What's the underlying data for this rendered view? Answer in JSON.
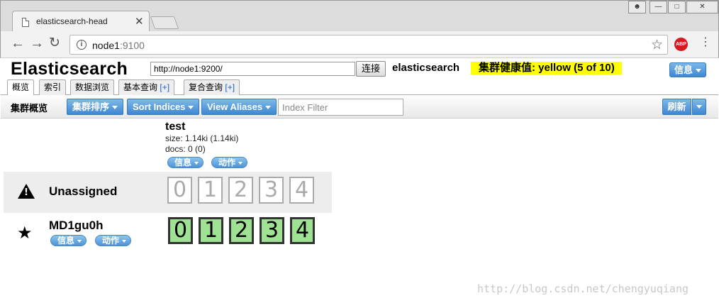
{
  "browser": {
    "tab_title": "elasticsearch-head",
    "url_host": "node1",
    "url_port": ":9100",
    "abp_label": "ABP"
  },
  "app": {
    "title": "Elasticsearch",
    "connect_url": "http://node1:9200/",
    "connect_button": "连接",
    "cluster_name": "elasticsearch",
    "health_text": "集群健康值: yellow (5 of 10)",
    "health_color": "#ffff00",
    "info_button": "信息"
  },
  "tabs": [
    {
      "label": "概览",
      "plus": ""
    },
    {
      "label": "索引",
      "plus": ""
    },
    {
      "label": "数据浏览",
      "plus": ""
    },
    {
      "label": "基本查询",
      "plus": "[+]"
    },
    {
      "label": "复合查询",
      "plus": "[+]"
    }
  ],
  "toolbar": {
    "title": "集群概览",
    "sort_button": "集群排序",
    "sort_indices_button": "Sort Indices",
    "view_aliases_button": "View Aliases",
    "index_filter_placeholder": "Index Filter",
    "refresh_button": "刷新"
  },
  "index": {
    "name": "test",
    "size": "size: 1.14ki (1.14ki)",
    "docs": "docs: 0 (0)",
    "info_label": "信息",
    "action_label": "动作"
  },
  "nodes": [
    {
      "label": "Unassigned",
      "shards": [
        "0",
        "1",
        "2",
        "3",
        "4"
      ],
      "shard_state": "unassigned"
    },
    {
      "label": "MD1gu0h",
      "info_label": "信息",
      "action_label": "动作",
      "shards": [
        "0",
        "1",
        "2",
        "3",
        "4"
      ],
      "shard_state": "assigned"
    }
  ],
  "colors": {
    "accent_blue": "#3e87d0",
    "assigned_shard": "#9fe293",
    "health_yellow": "#ffff00"
  },
  "watermark": "http://blog.csdn.net/chengyuqiang"
}
